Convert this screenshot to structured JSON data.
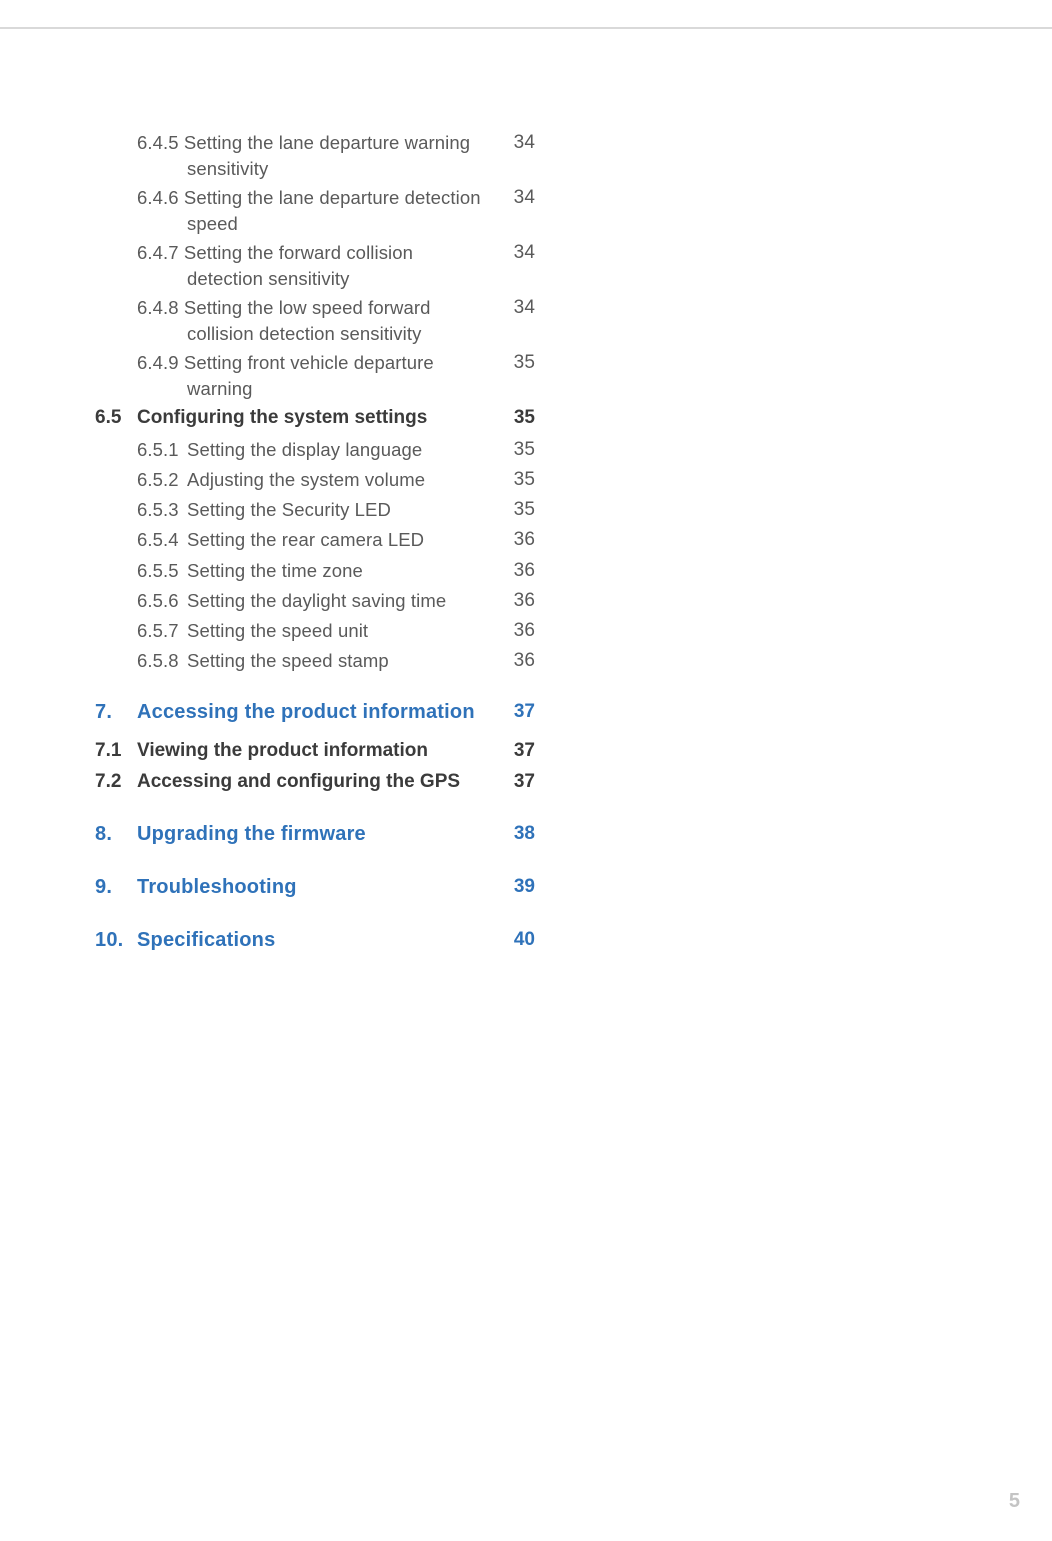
{
  "page_number": "5",
  "toc": {
    "leading_subs": [
      {
        "num": "6.4.5",
        "title": "Setting the lane departure warning sensitivity",
        "page": "34"
      },
      {
        "num": "6.4.6",
        "title": "Setting the lane departure detection speed",
        "page": "34"
      },
      {
        "num": "6.4.7",
        "title": "Setting the forward collision detection sensitivity",
        "page": "34"
      },
      {
        "num": "6.4.8",
        "title": "Setting the low speed forward collision detection sensitivity",
        "page": "34"
      },
      {
        "num": "6.4.9",
        "title": "Setting front vehicle departure warning",
        "page": "35"
      }
    ],
    "sec_6_5": {
      "num": "6.5",
      "title": "Configuring the system settings",
      "page": "35"
    },
    "sec_6_5_subs": [
      {
        "num": "6.5.1",
        "title": "Setting the display language",
        "page": "35"
      },
      {
        "num": "6.5.2",
        "title": "Adjusting the system volume",
        "page": "35"
      },
      {
        "num": "6.5.3",
        "title": "Setting the Security LED",
        "page": "35"
      },
      {
        "num": "6.5.4",
        "title": "Setting the rear camera LED",
        "page": "36"
      },
      {
        "num": "6.5.5",
        "title": "Setting the time zone",
        "page": "36"
      },
      {
        "num": "6.5.6",
        "title": "Setting the daylight saving time",
        "page": "36"
      },
      {
        "num": "6.5.7",
        "title": "Setting the speed unit",
        "page": "36"
      },
      {
        "num": "6.5.8",
        "title": "Setting the speed stamp",
        "page": "36"
      }
    ],
    "ch7": {
      "num": "7.",
      "title": "Accessing the product information",
      "page": "37"
    },
    "sec_7_1": {
      "num": "7.1",
      "title": "Viewing the product information",
      "page": "37"
    },
    "sec_7_2": {
      "num": "7.2",
      "title": "Accessing and configuring the GPS",
      "page": "37"
    },
    "ch8": {
      "num": "8.",
      "title": "Upgrading the firmware",
      "page": "38"
    },
    "ch9": {
      "num": "9.",
      "title": "Troubleshooting",
      "page": "39"
    },
    "ch10": {
      "num": "10.",
      "title": "Specifications",
      "page": "40"
    }
  }
}
